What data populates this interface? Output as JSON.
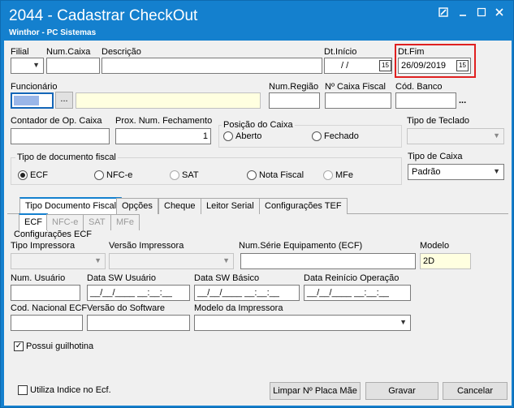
{
  "window": {
    "title": "2044 - Cadastrar CheckOut",
    "subtitle": "Winthor - PC Sistemas"
  },
  "header": {
    "filial_label": "Filial",
    "num_caixa_label": "Num.Caixa",
    "descricao_label": "Descrição",
    "dt_inicio_label": "Dt.Início",
    "dt_inicio_value": "/ /",
    "dt_fim_label": "Dt.Fim",
    "dt_fim_value": "26/09/2019",
    "calendar_glyph": "15"
  },
  "funcionario": {
    "label": "Funcionário",
    "lookup_button": "...",
    "num_regiao_label": "Num.Região",
    "num_caixa_fiscal_label": "Nº Caixa Fiscal",
    "cod_banco_label": "Cód. Banco",
    "cod_banco_button": "..."
  },
  "caixa": {
    "contador_label": "Contador de Op. Caixa",
    "prox_num_label": "Prox. Num. Fechamento",
    "prox_num_value": "1",
    "posicao_label": "Posição do Caixa",
    "posicao_aberto": "Aberto",
    "posicao_fechado": "Fechado",
    "tipo_teclado_label": "Tipo de Teclado"
  },
  "tipo_doc": {
    "label": "Tipo de documento fiscal",
    "options": [
      "ECF",
      "NFC-e",
      "SAT",
      "Nota Fiscal",
      "MFe"
    ],
    "tipo_caixa_label": "Tipo de Caixa",
    "tipo_caixa_value": "Padrão"
  },
  "tabs": [
    "Tipo Documento Fiscal",
    "Opções",
    "Cheque",
    "Leitor Serial",
    "Configurações TEF"
  ],
  "subtabs": [
    "ECF",
    "NFC-e",
    "SAT",
    "MFe"
  ],
  "ecf": {
    "config_label": "Configurações ECF",
    "tipo_impressora_label": "Tipo Impressora",
    "versao_impressora_label": "Versão Impressora",
    "num_serie_label": "Num.Série Equipamento (ECF)",
    "modelo_label": "Modelo",
    "modelo_value": "2D",
    "num_usuario_label": "Num. Usuário",
    "data_sw_usuario_label": "Data  SW Usuário",
    "data_sw_usuario_value": "__/__/____ __:__:__",
    "data_sw_basico_label": "Data SW Básico",
    "data_sw_basico_value": "__/__/____ __:__:__",
    "data_reinicio_label": "Data Reinício Operação",
    "data_reinicio_value": "__/__/____ __:__:__",
    "cod_nacional_label": "Cod. Nacional ECF",
    "versao_software_label": "Versão do Software",
    "modelo_impressora_label": "Modelo da Impressora",
    "possui_guilhotina_label": "Possui guilhotina"
  },
  "footer": {
    "utiliza_indice_label": "Utiliza Indice no Ecf.",
    "limpar_button": "Limpar Nº Placa Mãe",
    "gravar_button": "Gravar",
    "cancelar_button": "Cancelar"
  },
  "colors": {
    "title_bar": "#1480ce",
    "highlight_box": "#e02020",
    "readonly_yellow": "#ffffe0",
    "focus_blue": "#9ab6e8"
  }
}
